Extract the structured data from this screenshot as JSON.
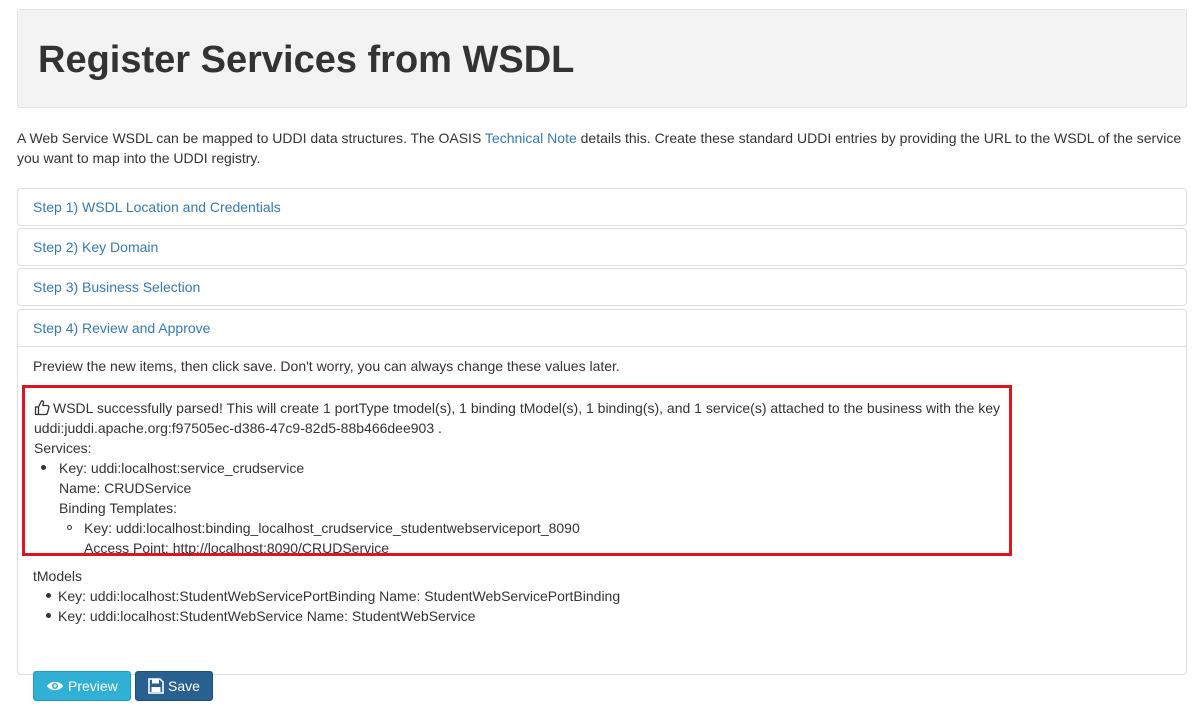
{
  "header": {
    "title": "Register Services from WSDL"
  },
  "intro": {
    "before": "A Web Service WSDL can be mapped to UDDI data structures. The OASIS ",
    "link": "Technical Note",
    "after": " details this. Create these standard UDDI entries by providing the URL to the WSDL of the service",
    "line2": "you want to map into the UDDI registry."
  },
  "steps": [
    {
      "label": "Step 1) WSDL Location and Credentials"
    },
    {
      "label": "Step 2) Key Domain"
    },
    {
      "label": "Step 3) Business Selection"
    },
    {
      "label": "Step 4) Review and Approve"
    }
  ],
  "review": {
    "preview_text": "Preview the new items, then click save. Don't worry, you can always change these values later.",
    "alert": {
      "message": "WSDL successfully parsed! This will create 1 portType tmodel(s), 1 binding tModel(s), 1 binding(s), and 1 service(s) attached to the business with the key",
      "business_key": "uddi:juddi.apache.org:f97505ec-d386-47c9-82d5-88b466dee903 .",
      "services_label": "Services:",
      "service_key": "Key: uddi:localhost:service_crudservice",
      "service_name": "Name: CRUDService",
      "binding_label": "Binding Templates:",
      "binding_key": "Key: uddi:localhost:binding_localhost_crudservice_studentwebserviceport_8090",
      "access_point": "Access Point: http://localhost:8090/CRUDService"
    },
    "tmodels_label": "tModels",
    "tmodels": [
      "Key: uddi:localhost:StudentWebServicePortBinding Name: StudentWebServicePortBinding",
      "Key: uddi:localhost:StudentWebService Name: StudentWebService"
    ],
    "buttons": {
      "preview": "Preview",
      "save": "Save"
    }
  },
  "icons": {
    "alert": "thumbs-up-icon",
    "preview": "eye-icon",
    "save": "floppy-disk-icon"
  },
  "colors": {
    "link": "#337ab7",
    "alert_border": "#e0141e",
    "preview_btn": "#31b0d5",
    "save_btn": "#286090"
  }
}
